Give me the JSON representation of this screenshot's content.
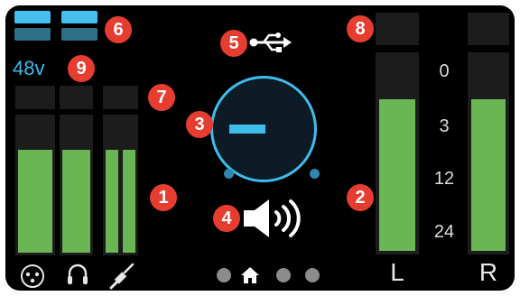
{
  "phantom_power": {
    "label": "48v"
  },
  "markers": {
    "m1": "1",
    "m2": "2",
    "m3": "3",
    "m4": "4",
    "m5": "5",
    "m6": "6",
    "m7": "7",
    "m8": "8",
    "m9": "9"
  },
  "output_meter": {
    "scale": [
      "0",
      "3",
      "12",
      "24"
    ],
    "left_label": "L",
    "right_label": "R",
    "left_level": 0.77,
    "right_level": 0.77
  },
  "input_meters": {
    "mic_level": 0.76,
    "headphone_level": 0.76,
    "instrument_level": 0.76
  },
  "input_icons": [
    "xlr-mic-icon",
    "headphone-icon",
    "instrument-jack-icon"
  ],
  "volume_icon": "speaker-volume-icon",
  "usb_icon": "usb-icon",
  "pagination": {
    "pages": 4,
    "current": 2
  },
  "colors": {
    "accent": "#3ebcec",
    "meter": "#6ab654",
    "marker": "#e63d30",
    "background": "#000000"
  }
}
